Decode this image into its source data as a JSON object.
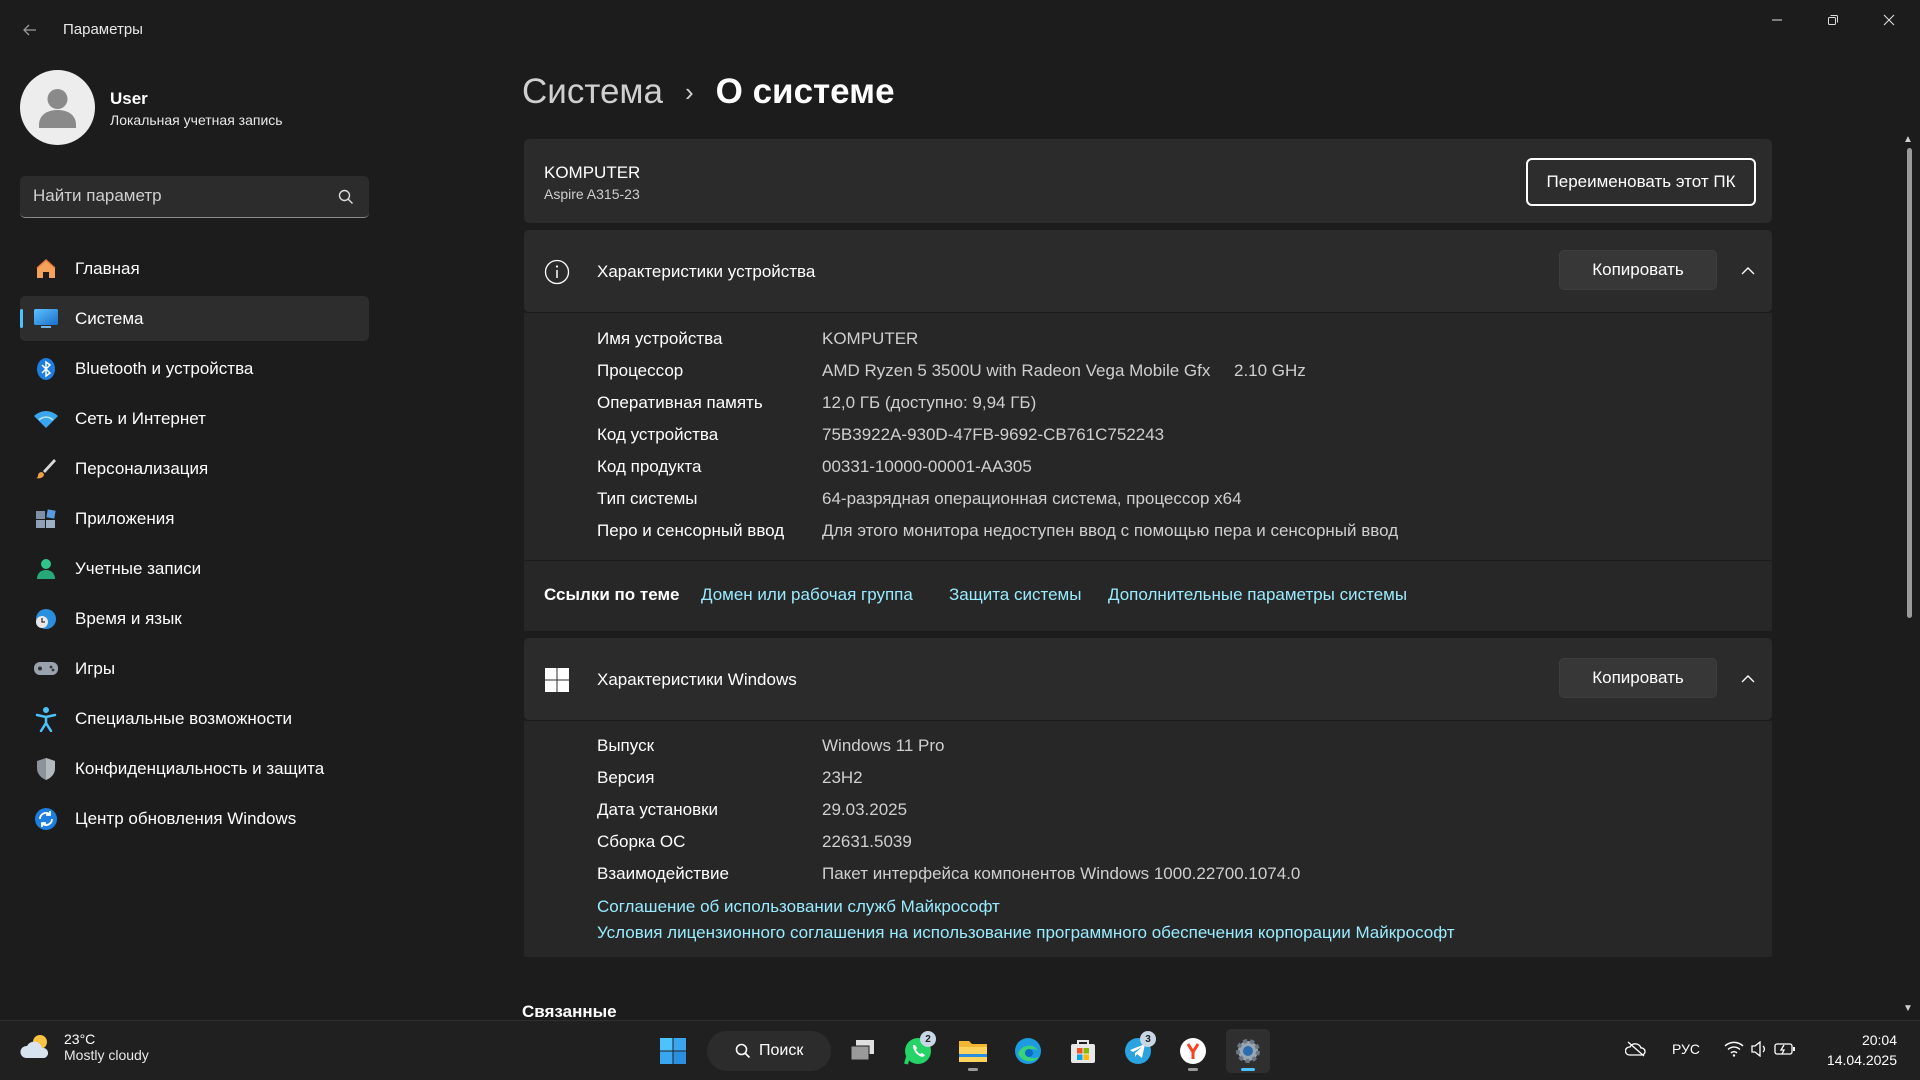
{
  "window": {
    "title": "Параметры",
    "back_icon": "back-arrow-icon",
    "minimize_icon": "minimize-icon",
    "maximize_icon": "restore-icon",
    "close_icon": "close-icon"
  },
  "user": {
    "name": "User",
    "account_type": "Локальная учетная запись"
  },
  "search": {
    "placeholder": "Найти параметр",
    "icon": "search-icon"
  },
  "nav": {
    "items": [
      {
        "label": "Главная",
        "icon": "home-icon",
        "active": false
      },
      {
        "label": "Система",
        "icon": "system-icon",
        "active": true
      },
      {
        "label": "Bluetooth и устройства",
        "icon": "bluetooth-icon",
        "active": false
      },
      {
        "label": "Сеть и Интернет",
        "icon": "wifi-icon",
        "active": false
      },
      {
        "label": "Персонализация",
        "icon": "brush-icon",
        "active": false
      },
      {
        "label": "Приложения",
        "icon": "apps-icon",
        "active": false
      },
      {
        "label": "Учетные записи",
        "icon": "accounts-icon",
        "active": false
      },
      {
        "label": "Время и язык",
        "icon": "time-language-icon",
        "active": false
      },
      {
        "label": "Игры",
        "icon": "gamepad-icon",
        "active": false
      },
      {
        "label": "Специальные возможности",
        "icon": "accessibility-icon",
        "active": false
      },
      {
        "label": "Конфиденциальность и защита",
        "icon": "shield-icon",
        "active": false
      },
      {
        "label": "Центр обновления Windows",
        "icon": "update-icon",
        "active": false
      }
    ]
  },
  "header": {
    "parent": "Система",
    "separator": "›",
    "current": "О системе"
  },
  "pc": {
    "name": "KOMPUTER",
    "model": "Aspire A315-23",
    "rename_label": "Переименовать этот ПК"
  },
  "device_specs": {
    "title": "Характеристики устройства",
    "icon": "info-icon",
    "copy_label": "Копировать",
    "chevron_icon": "chevron-up-icon",
    "rows": [
      {
        "key": "Имя устройства",
        "value": "KOMPUTER"
      },
      {
        "key": "Процессор",
        "value": "AMD Ryzen 5 3500U with Radeon Vega Mobile Gfx     2.10 GHz"
      },
      {
        "key": "Оперативная память",
        "value": "12,0 ГБ (доступно: 9,94 ГБ)"
      },
      {
        "key": "Код устройства",
        "value": "75B3922A-930D-47FB-9692-CB761C752243"
      },
      {
        "key": "Код продукта",
        "value": "00331-10000-00001-AA305"
      },
      {
        "key": "Тип системы",
        "value": "64-разрядная операционная система, процессор x64"
      },
      {
        "key": "Перо и сенсорный ввод",
        "value": "Для этого монитора недоступен ввод с помощью пера и сенсорный ввод"
      }
    ]
  },
  "related_links": {
    "title": "Ссылки по теме",
    "links": [
      "Домен или рабочая группа",
      "Защита системы",
      "Дополнительные параметры системы"
    ]
  },
  "windows_specs": {
    "title": "Характеристики Windows",
    "icon": "windows-logo-icon",
    "copy_label": "Копировать",
    "chevron_icon": "chevron-up-icon",
    "rows": [
      {
        "key": "Выпуск",
        "value": "Windows 11 Pro"
      },
      {
        "key": "Версия",
        "value": "23H2"
      },
      {
        "key": "Дата установки",
        "value": "29.03.2025"
      },
      {
        "key": "Сборка ОС",
        "value": "22631.5039"
      },
      {
        "key": "Взаимодействие",
        "value": "Пакет интерфейса компонентов Windows 1000.22700.1074.0"
      }
    ],
    "links": [
      "Соглашение об использовании служб Майкрософт",
      "Условия лицензионного соглашения на использование программного обеспечения корпорации Майкрософт"
    ]
  },
  "related": {
    "title": "Связанные"
  },
  "taskbar": {
    "weather": {
      "temp": "23°C",
      "condition": "Mostly cloudy",
      "icon": "partly-cloudy-icon"
    },
    "search_label": "Поиск",
    "apps": [
      {
        "name": "start-button",
        "icon": "windows-start-icon",
        "badge": ""
      },
      {
        "name": "task-view",
        "icon": "task-view-icon",
        "badge": ""
      },
      {
        "name": "whatsapp",
        "icon": "whatsapp-icon",
        "badge": "2"
      },
      {
        "name": "file-explorer",
        "icon": "folder-icon",
        "badge": ""
      },
      {
        "name": "edge",
        "icon": "edge-icon",
        "badge": ""
      },
      {
        "name": "store",
        "icon": "store-icon",
        "badge": ""
      },
      {
        "name": "telegram",
        "icon": "telegram-icon",
        "badge": "3"
      },
      {
        "name": "yandex",
        "icon": "yandex-browser-icon",
        "badge": ""
      },
      {
        "name": "settings",
        "icon": "gear-icon",
        "badge": ""
      }
    ],
    "tray": {
      "language": "РУС",
      "time": "20:04",
      "date": "14.04.2025"
    }
  },
  "colors": {
    "background": "#1c1c1c",
    "card": "#2b2b2b",
    "accent": "#4cc2ff",
    "link": "#99ebff"
  }
}
